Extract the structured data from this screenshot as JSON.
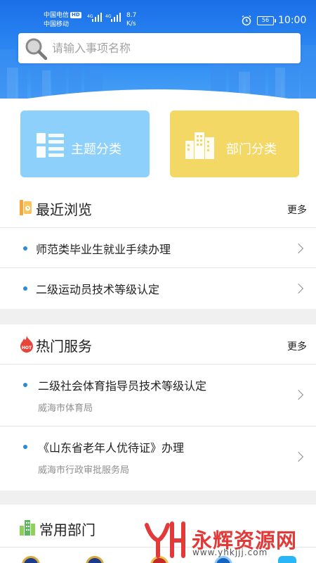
{
  "status_bar": {
    "carrier_1": "中国电信",
    "carrier_1_badge": "HD",
    "carrier_2": "中国移动",
    "network_1": "4G",
    "network_2": "4G",
    "speed_value": "8.7",
    "speed_unit": "K/s",
    "battery": "56",
    "time": "10:00"
  },
  "search": {
    "placeholder": "请输入事项名称",
    "value": ""
  },
  "categories": [
    {
      "label": "主题分类",
      "icon": "list-grid-icon",
      "color": "#8dd0fb"
    },
    {
      "label": "部门分类",
      "icon": "buildings-icon",
      "color": "#f3d866"
    }
  ],
  "recent": {
    "title": "最近浏览",
    "more": "更多",
    "items": [
      {
        "title": "师范类毕业生就业手续办理"
      },
      {
        "title": "二级运动员技术等级认定"
      }
    ]
  },
  "hot": {
    "title": "热门服务",
    "more": "更多",
    "badge": "HOT",
    "items": [
      {
        "title": "二级社会体育指导员技术等级认定",
        "dept": "威海市体育局"
      },
      {
        "title": "《山东省老年人优待证》办理",
        "dept": "威海市行政审批服务局"
      }
    ]
  },
  "departments": {
    "title": "常用部门"
  },
  "watermark": {
    "text": "永辉资源网",
    "url": "www.yhkjjj.com"
  },
  "colors": {
    "header_blue": "#1a6fe8",
    "bullet": "#2b8bd6",
    "theme_card": "#8dd0fb",
    "dept_card": "#f3d866",
    "watermark_red": "#e23a39"
  }
}
